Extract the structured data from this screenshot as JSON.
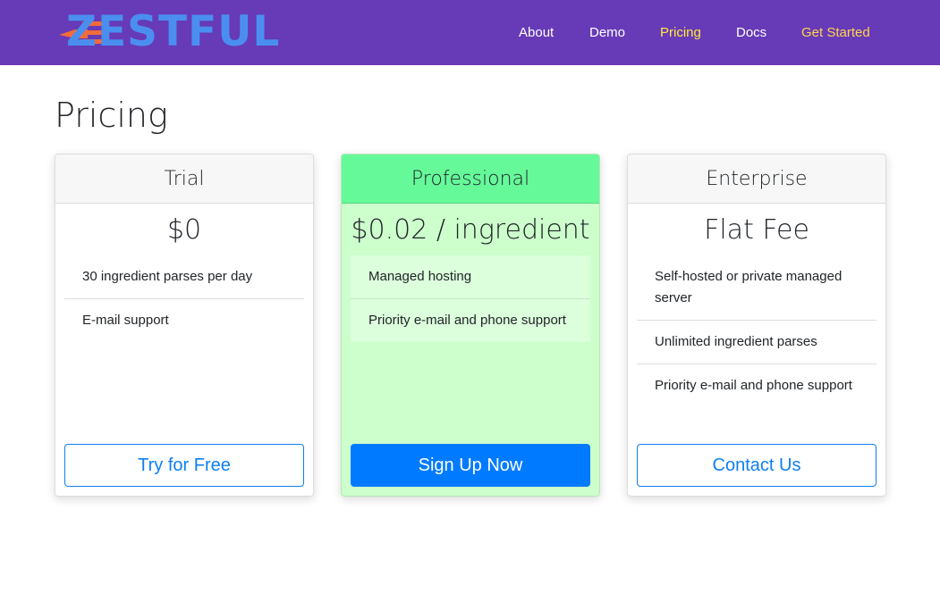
{
  "brand": {
    "logo_text": "ZESTFUL",
    "logo_text_color": "#4a8ff0",
    "logo_fork_color": "#f26b3a"
  },
  "nav": {
    "about": "About",
    "demo": "Demo",
    "pricing": "Pricing",
    "docs": "Docs",
    "get_started": "Get Started"
  },
  "colors": {
    "navbar": "#673ab7",
    "active_link": "#ffeb3b",
    "primary": "#007bff",
    "pro_card": "#ccffcc",
    "pro_header": "#66f99a"
  },
  "page": {
    "title": "Pricing"
  },
  "plans": [
    {
      "name": "Trial",
      "price": "$0",
      "features": [
        "30 ingredient parses per day",
        "E-mail support"
      ],
      "button": "Try for Free"
    },
    {
      "name": "Professional",
      "price": "$0.02 / ingredient",
      "features": [
        "Managed hosting",
        "Priority e-mail and phone support"
      ],
      "button": "Sign Up Now"
    },
    {
      "name": "Enterprise",
      "price": "Flat Fee",
      "features": [
        "Self-hosted or private managed server",
        "Unlimited ingredient parses",
        "Priority e-mail and phone support"
      ],
      "button": "Contact Us"
    }
  ]
}
